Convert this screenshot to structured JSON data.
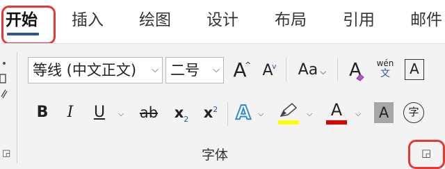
{
  "tabs": [
    {
      "label": "开始"
    },
    {
      "label": "插入"
    },
    {
      "label": "绘图"
    },
    {
      "label": "设计"
    },
    {
      "label": "布局"
    },
    {
      "label": "引用"
    },
    {
      "label": "邮件"
    }
  ],
  "font_group": {
    "font_name": "等线 (中文正文)",
    "font_size": "二号",
    "grow_font": "A",
    "shrink_font": "A",
    "change_case": "Aa",
    "clear_formatting": "A",
    "phonetic_guide_top": "wén",
    "phonetic_guide_bottom": "文",
    "character_border": "A",
    "bold": "B",
    "italic": "I",
    "underline": "U",
    "strikethrough": "ab",
    "subscript": "x",
    "subscript_mark": "2",
    "superscript": "x",
    "superscript_mark": "2",
    "text_effects": "A",
    "font_color": "A",
    "character_shading": "A",
    "enclose_characters": "字",
    "label": "字体"
  },
  "colors": {
    "accent": "#2b579a",
    "highlight": "#ffff00",
    "font_color": "#e00000",
    "annotation": "#e53935"
  }
}
